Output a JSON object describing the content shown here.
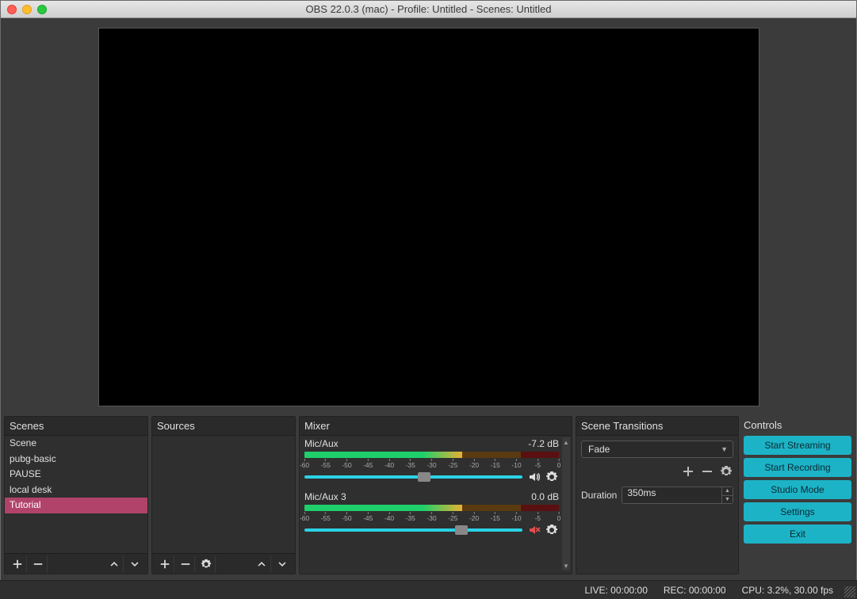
{
  "titlebar": {
    "title": "OBS 22.0.3 (mac) - Profile: Untitled - Scenes: Untitled"
  },
  "panels": {
    "scenes_label": "Scenes",
    "sources_label": "Sources",
    "mixer_label": "Mixer",
    "transitions_label": "Scene Transitions",
    "controls_label": "Controls"
  },
  "scenes": {
    "items": [
      {
        "label": "Scene",
        "selected": false
      },
      {
        "label": "pubg-basic",
        "selected": false
      },
      {
        "label": "PAUSE",
        "selected": false
      },
      {
        "label": "local desk",
        "selected": false
      },
      {
        "label": "Tutorial",
        "selected": true
      }
    ]
  },
  "mixer": {
    "channels": [
      {
        "name": "Mic/Aux",
        "db": "-7.2 dB",
        "level_pct": 62,
        "slider_pct": 55,
        "muted": false
      },
      {
        "name": "Mic/Aux 3",
        "db": "0.0 dB",
        "level_pct": 62,
        "slider_pct": 72,
        "muted": true
      }
    ],
    "scale": [
      "-60",
      "-55",
      "-50",
      "-45",
      "-40",
      "-35",
      "-30",
      "-25",
      "-20",
      "-15",
      "-10",
      "-5",
      "0"
    ]
  },
  "transitions": {
    "selected": "Fade",
    "duration_label": "Duration",
    "duration_value": "350ms"
  },
  "controls": {
    "buttons": [
      {
        "label": "Start Streaming"
      },
      {
        "label": "Start Recording"
      },
      {
        "label": "Studio Mode"
      },
      {
        "label": "Settings"
      },
      {
        "label": "Exit"
      }
    ]
  },
  "status": {
    "live": "LIVE: 00:00:00",
    "rec": "REC: 00:00:00",
    "cpu": "CPU: 3.2%, 30.00 fps"
  }
}
